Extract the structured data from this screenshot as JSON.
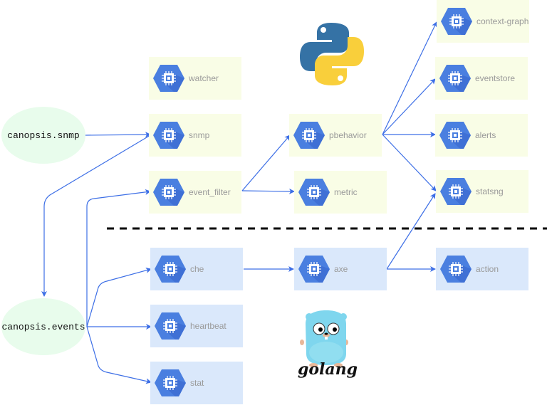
{
  "queues": [
    {
      "id": "snmp-queue",
      "label": "canopsis.snmp"
    },
    {
      "id": "events-queue",
      "label": "canopsis.events"
    }
  ],
  "python_engines": [
    {
      "label": "watcher"
    },
    {
      "label": "snmp"
    },
    {
      "label": "event_filter"
    },
    {
      "label": "pbehavior"
    },
    {
      "label": "metric"
    },
    {
      "label": "context-graph"
    },
    {
      "label": "eventstore"
    },
    {
      "label": "alerts"
    },
    {
      "label": "statsng"
    }
  ],
  "go_engines": [
    {
      "label": "che"
    },
    {
      "label": "heartbeat"
    },
    {
      "label": "stat"
    },
    {
      "label": "axe"
    },
    {
      "label": "action"
    }
  ],
  "logos": {
    "python": "python-logo",
    "golang": "golang",
    "golang_text": "golang"
  },
  "colors": {
    "edge": "#3d6fe6",
    "hex": "#4a7fe0",
    "python_box": "#f9fde6",
    "go_box": "#dae8fb",
    "queue": "#e8fcec"
  }
}
